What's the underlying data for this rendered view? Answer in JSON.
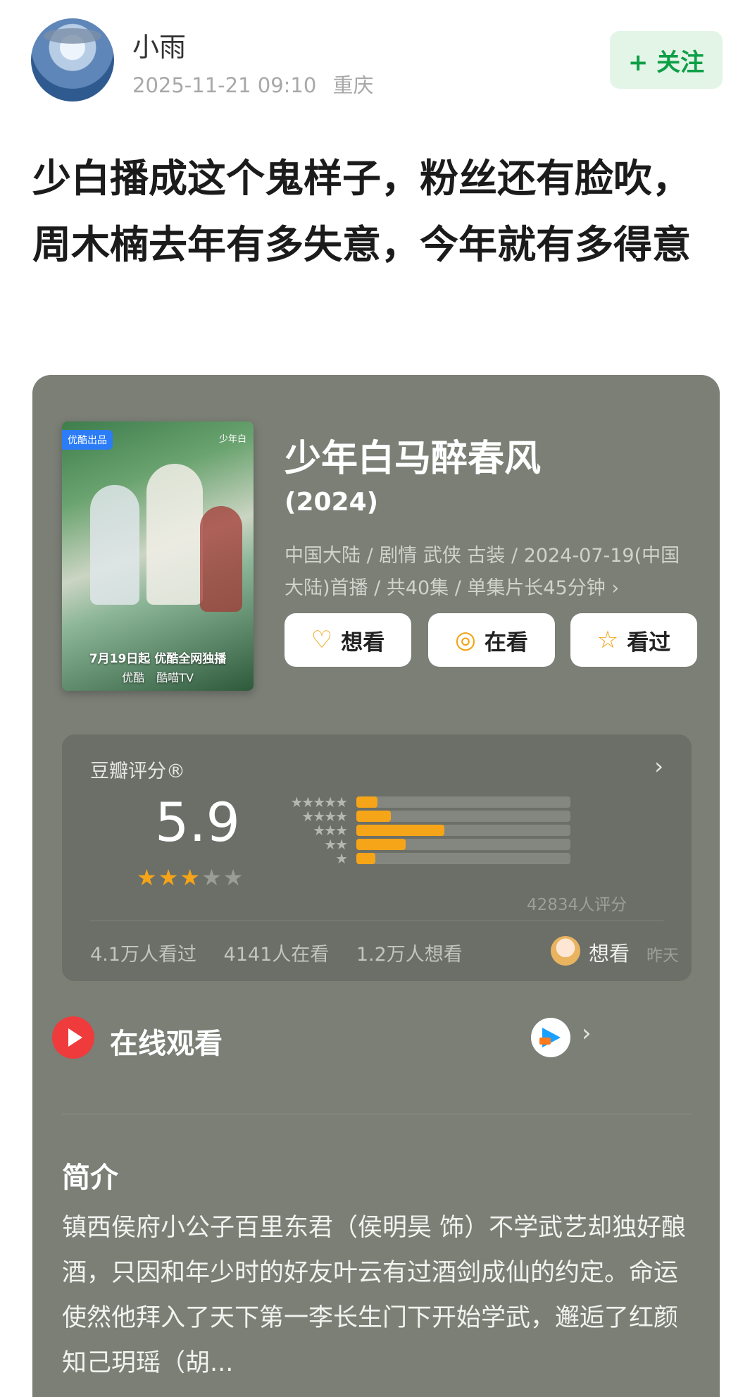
{
  "author": {
    "name": "小雨",
    "time": "2025-11-21 09:10",
    "location": "重庆",
    "follow_label": "+ 关注"
  },
  "post": {
    "title": "少白播成这个鬼样子，粉丝还有脸吹，周木楠去年有多失意，今年就有多得意"
  },
  "movie": {
    "title": "少年白马醉春风",
    "year": "(2024)",
    "info": "中国大陆 / 剧情 武侠 古装 / 2024-07-19(中国大陆)首播 / 共40集 / 单集片长45分钟 ›",
    "poster": {
      "badge": "优酷出品",
      "brand": "少年白",
      "date_text": "7月19日起 优酷全网独播",
      "platforms": [
        "优酷",
        "酷喵TV"
      ]
    },
    "actions": {
      "want": "想看",
      "watching": "在看",
      "watched": "看过"
    }
  },
  "rating": {
    "label": "豆瓣评分®",
    "score": "5.9",
    "stars_filled": 3,
    "distribution": [
      {
        "stars": 5,
        "fraction": 0.1
      },
      {
        "stars": 4,
        "fraction": 0.16
      },
      {
        "stars": 3,
        "fraction": 0.41
      },
      {
        "stars": 2,
        "fraction": 0.23
      },
      {
        "stars": 1,
        "fraction": 0.09
      }
    ],
    "count": "42834人评分",
    "stats": {
      "watched": "4.1万人看过",
      "watching": "4141人在看",
      "want": "1.2万人想看"
    },
    "friend": {
      "action": "想看",
      "time": "昨天"
    }
  },
  "online": {
    "label": "在线观看"
  },
  "intro": {
    "title": "简介",
    "text": "镇西侯府小公子百里东君（侯明昊 饰）不学武艺却独好酿酒，只因和年少时的好友叶云有过酒剑成仙的约定。命运使然他拜入了天下第一李长生门下开始学武，邂逅了红颜知己玥瑶（胡..."
  },
  "colors": {
    "card_bg": "#7b7f76",
    "accent_orange": "#f6a418",
    "follow_green": "#0e9f46"
  },
  "icons": [
    "heart-plus-icon",
    "target-icon",
    "star-icon",
    "chevron-right-icon",
    "play-icon",
    "youku-icon"
  ]
}
